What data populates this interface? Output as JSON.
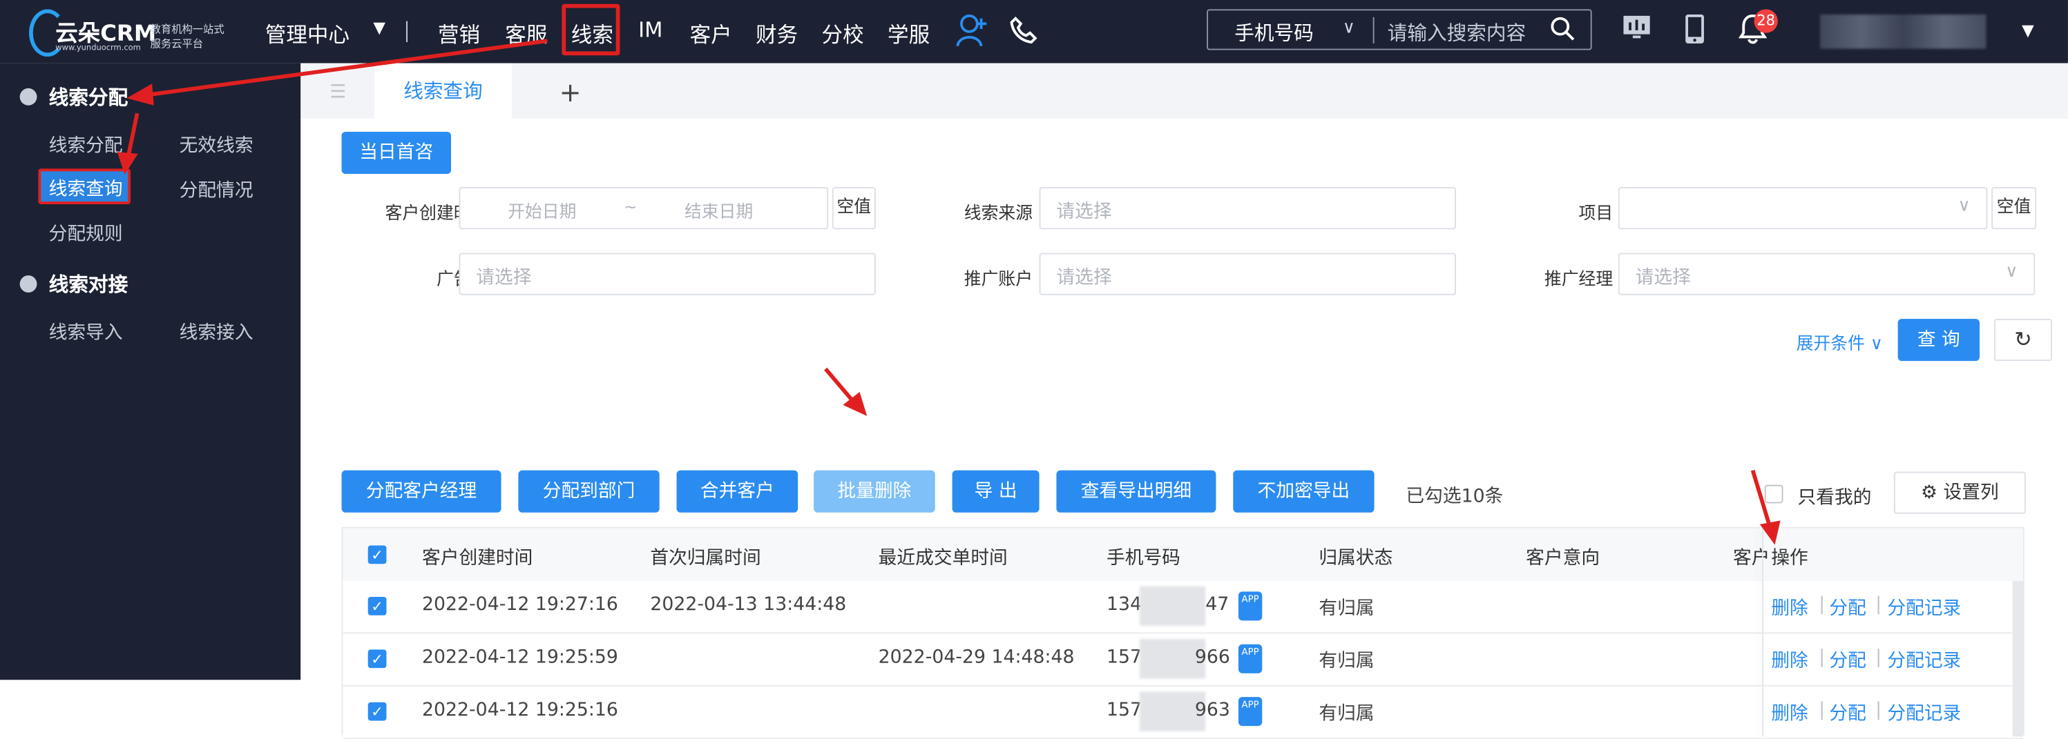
{
  "app": {
    "logo_name": "云朵CRM",
    "logo_url": "www.yunduocrm.com",
    "logo_slogan": "教育机构一站式服务云平台"
  },
  "topnav": {
    "management": "管理中心",
    "items": [
      "营销",
      "客服",
      "线索",
      "IM",
      "客户",
      "财务",
      "分校",
      "学服"
    ],
    "active": "线索",
    "search_type": "手机号码",
    "search_placeholder": "请输入搜索内容",
    "notification_count": "28"
  },
  "sidebar": {
    "group1_title": "线索分配",
    "group1_items": [
      "线索分配",
      "无效线索",
      "线索查询",
      "分配情况",
      "分配规则"
    ],
    "active_item": "线索查询",
    "group2_title": "线索对接",
    "group2_items": [
      "线索导入",
      "线索接入"
    ]
  },
  "tabs": {
    "current": "线索查询",
    "add": "+"
  },
  "filters": {
    "today_first": "当日首咨",
    "create_time_label": "客户创建时间",
    "start_date_ph": "开始日期",
    "date_sep": "~",
    "end_date_ph": "结束日期",
    "clear1": "空值",
    "source_label": "线索来源",
    "source_ph": "请选择",
    "project_label": "项目",
    "clear2": "空值",
    "advertiser_label": "广告商",
    "advertiser_ph": "请选择",
    "promo_account_label": "推广账户",
    "promo_account_ph": "请选择",
    "promo_manager_label": "推广经理",
    "promo_manager_ph": "请选择",
    "expand": "展开条件",
    "query": "查 询"
  },
  "actions": {
    "buttons": [
      "分配客户经理",
      "分配到部门",
      "合并客户",
      "批量删除",
      "导 出",
      "查看导出明细",
      "不加密导出"
    ],
    "selected_count": "已勾选10条",
    "only_mine": "只看我的",
    "set_columns": "设置列"
  },
  "table": {
    "headers": [
      "客户创建时间",
      "首次归属时间",
      "最近成交单时间",
      "手机号码",
      "归属状态",
      "客户意向",
      "客户",
      "操作"
    ],
    "rows": [
      {
        "created": "2022-04-12 19:27:16",
        "first_assigned": "2022-04-13 13:44:48",
        "last_deal": "",
        "phone_prefix": "134",
        "phone_suffix": "47",
        "status": "有归属"
      },
      {
        "created": "2022-04-12 19:25:59",
        "first_assigned": "",
        "last_deal": "2022-04-29 14:48:48",
        "phone_prefix": "157",
        "phone_suffix": "966",
        "status": "有归属"
      },
      {
        "created": "2022-04-12 19:25:16",
        "first_assigned": "",
        "last_deal": "",
        "phone_prefix": "157",
        "phone_suffix": "963",
        "status": "有归属"
      }
    ],
    "ops": [
      "删除",
      "分配",
      "分配记录"
    ],
    "app_label": "APP"
  },
  "colors": {
    "dark_bg": "#1c2233",
    "primary": "#2a8cf0",
    "annotation_red": "#e02020"
  }
}
